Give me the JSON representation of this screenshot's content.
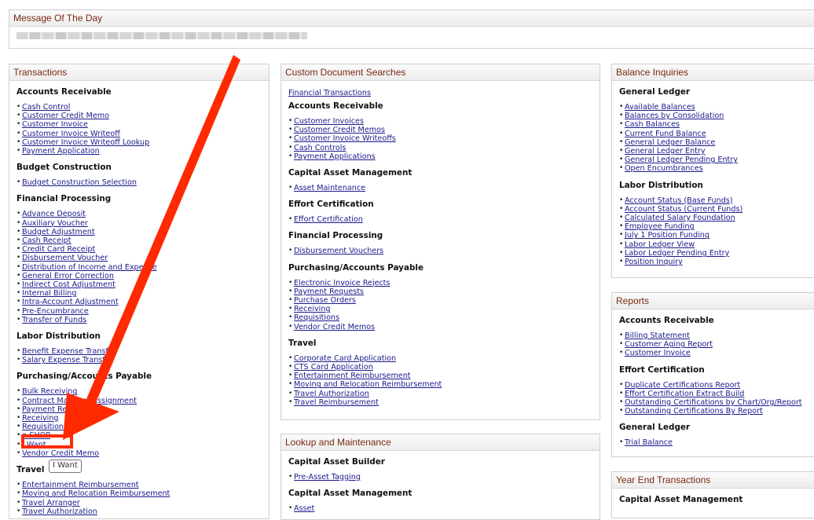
{
  "motd": {
    "title": "Message Of The Day"
  },
  "transactions": {
    "title": "Transactions",
    "sections": [
      {
        "heading": "Accounts Receivable",
        "links": [
          "Cash Control",
          "Customer Credit Memo",
          "Customer Invoice",
          "Customer Invoice Writeoff",
          "Customer Invoice Writeoff Lookup",
          "Payment Application"
        ]
      },
      {
        "heading": "Budget Construction",
        "links": [
          "Budget Construction Selection"
        ]
      },
      {
        "heading": "Financial Processing",
        "links": [
          "Advance Deposit",
          "Auxiliary Voucher",
          "Budget Adjustment",
          "Cash Receipt",
          "Credit Card Receipt",
          "Disbursement Voucher",
          "Distribution of Income and Expense",
          "General Error Correction",
          "Indirect Cost Adjustment",
          "Internal Billing",
          "Intra-Account Adjustment",
          "Pre-Encumbrance",
          "Transfer of Funds"
        ]
      },
      {
        "heading": "Labor Distribution",
        "links": [
          "Benefit Expense Transfer",
          "Salary Expense Transfer"
        ]
      },
      {
        "heading": "Purchasing/Accounts Payable",
        "links": [
          "Bulk Receiving",
          "Contract Manager Assignment",
          "Payment Request",
          "Receiving",
          "Requisition",
          "e-SHOP",
          "I Want",
          "Vendor Credit Memo"
        ]
      },
      {
        "heading": "Travel",
        "links": [
          "Entertainment Reimbursement",
          "Moving and Relocation Reimbursement",
          "Travel Arranger",
          "Travel Authorization"
        ]
      }
    ]
  },
  "custom_searches": {
    "title": "Custom Document Searches",
    "top_link": "Financial Transactions",
    "sections": [
      {
        "heading": "Accounts Receivable",
        "links": [
          "Customer Invoices",
          "Customer Credit Memos",
          "Customer Invoice Writeoffs",
          "Cash Controls",
          "Payment Applications"
        ]
      },
      {
        "heading": "Capital Asset Management",
        "links": [
          "Asset Maintenance"
        ]
      },
      {
        "heading": "Effort Certification",
        "links": [
          "Effort Certification"
        ]
      },
      {
        "heading": "Financial Processing",
        "links": [
          "Disbursement Vouchers"
        ]
      },
      {
        "heading": "Purchasing/Accounts Payable",
        "links": [
          "Electronic Invoice Rejects",
          "Payment Requests",
          "Purchase Orders",
          "Receiving",
          "Requisitions",
          "Vendor Credit Memos"
        ]
      },
      {
        "heading": "Travel",
        "links": [
          "Corporate Card Application",
          "CTS Card Application",
          "Entertainment Reimbursement",
          "Moving and Relocation Reimbursement",
          "Travel Authorization",
          "Travel Reimbursement"
        ]
      }
    ]
  },
  "lookup_maintenance": {
    "title": "Lookup and Maintenance",
    "sections": [
      {
        "heading": "Capital Asset Builder",
        "links": [
          "Pre-Asset Tagging"
        ]
      },
      {
        "heading": "Capital Asset Management",
        "links": [
          "Asset"
        ]
      }
    ]
  },
  "balance_inquiries": {
    "title": "Balance Inquiries",
    "sections": [
      {
        "heading": "General Ledger",
        "links": [
          "Available Balances",
          "Balances by Consolidation",
          "Cash Balances",
          "Current Fund Balance",
          "General Ledger Balance",
          "General Ledger Entry",
          "General Ledger Pending Entry",
          "Open Encumbrances"
        ]
      },
      {
        "heading": "Labor Distribution",
        "links": [
          "Account Status (Base Funds)",
          "Account Status (Current Funds)",
          "Calculated Salary Foundation",
          "Employee Funding",
          "July 1 Position Funding",
          "Labor Ledger View",
          "Labor Ledger Pending Entry",
          "Position Inquiry"
        ]
      }
    ]
  },
  "reports": {
    "title": "Reports",
    "sections": [
      {
        "heading": "Accounts Receivable",
        "links": [
          "Billing Statement",
          "Customer Aging Report",
          "Customer Invoice"
        ]
      },
      {
        "heading": "Effort Certification",
        "links": [
          "Duplicate Certifications Report",
          "Effort Certification Extract Build",
          "Outstanding Certifications by Chart/Org/Report",
          "Outstanding Certifications By Report"
        ]
      },
      {
        "heading": "General Ledger",
        "links": [
          "Trial Balance"
        ]
      }
    ]
  },
  "year_end": {
    "title": "Year End Transactions",
    "sections": [
      {
        "heading": "Capital Asset Management",
        "links": []
      }
    ]
  },
  "tooltip": {
    "text": "I Want"
  },
  "annotation": {
    "color": "#ff2a00"
  }
}
